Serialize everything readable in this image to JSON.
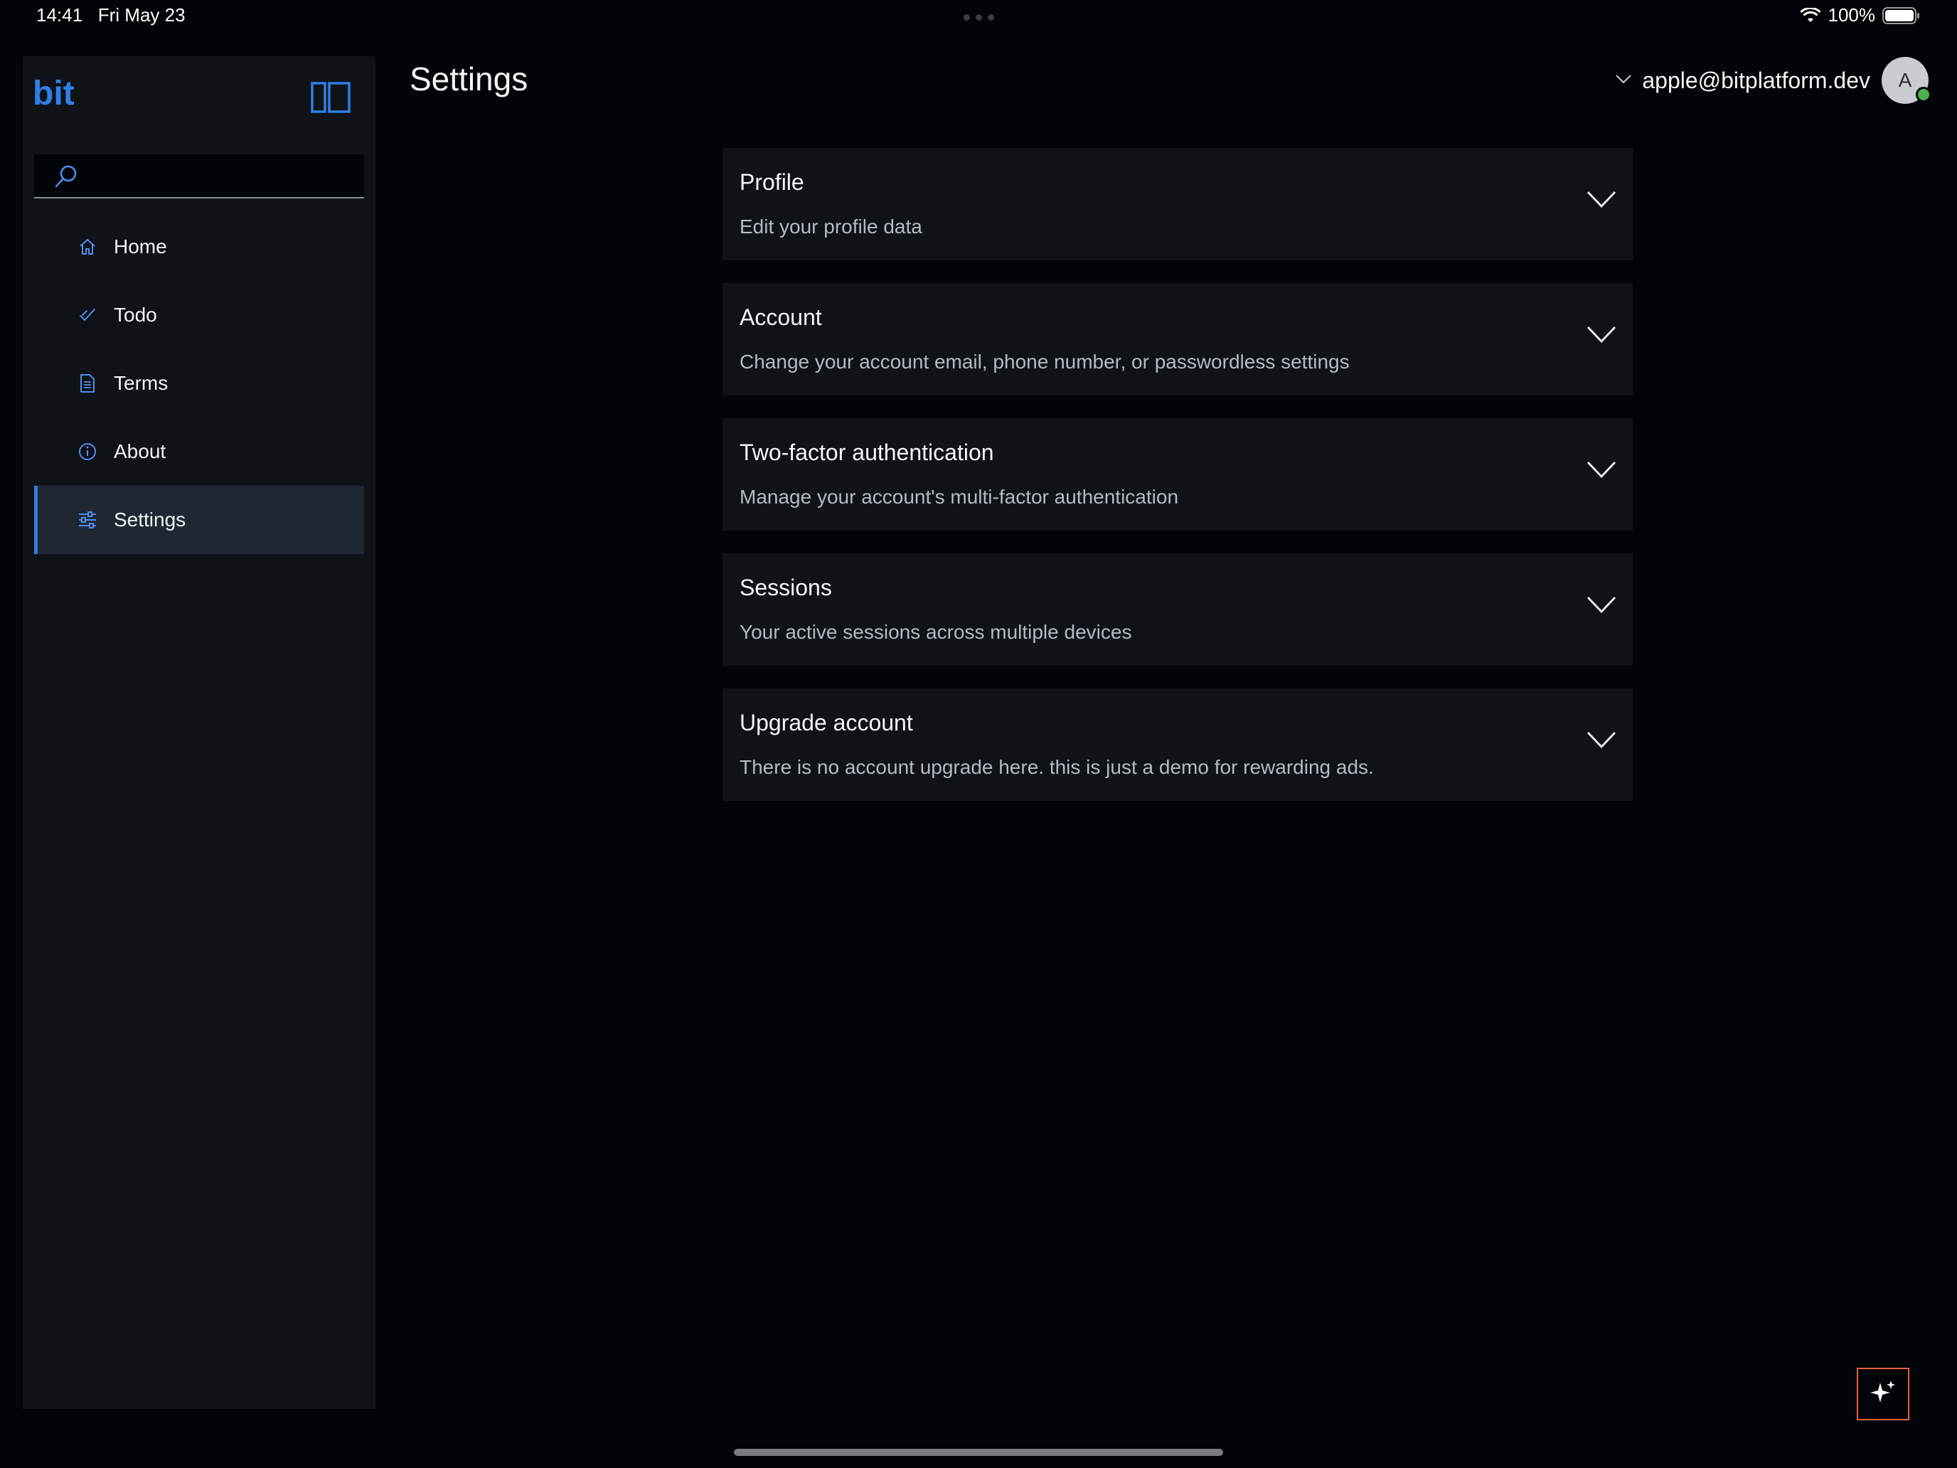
{
  "status_bar": {
    "time": "14:41",
    "date": "Fri May 23",
    "battery": "100%"
  },
  "app": {
    "logo_text": "bit"
  },
  "search": {
    "placeholder": ""
  },
  "sidebar": {
    "items": [
      {
        "label": "Home",
        "icon": "home-icon",
        "active": false
      },
      {
        "label": "Todo",
        "icon": "checkmark-icon",
        "active": false
      },
      {
        "label": "Terms",
        "icon": "document-icon",
        "active": false
      },
      {
        "label": "About",
        "icon": "info-icon",
        "active": false
      },
      {
        "label": "Settings",
        "icon": "sliders-icon",
        "active": true
      }
    ]
  },
  "header": {
    "title": "Settings",
    "user_email": "apple@bitplatform.dev",
    "avatar_initial": "A"
  },
  "settings_sections": [
    {
      "title": "Profile",
      "description": "Edit your profile data"
    },
    {
      "title": "Account",
      "description": "Change your account email, phone number, or passwordless settings"
    },
    {
      "title": "Two-factor authentication",
      "description": "Manage your account's multi-factor authentication"
    },
    {
      "title": "Sessions",
      "description": "Your active sessions across multiple devices"
    },
    {
      "title": "Upgrade account",
      "description": "There is no account upgrade here. this is just a demo for rewarding ads."
    }
  ],
  "colors": {
    "accent": "#2f7fe6",
    "background": "#010409",
    "panel": "#0f1217",
    "ai_button_border": "#e8623d"
  }
}
